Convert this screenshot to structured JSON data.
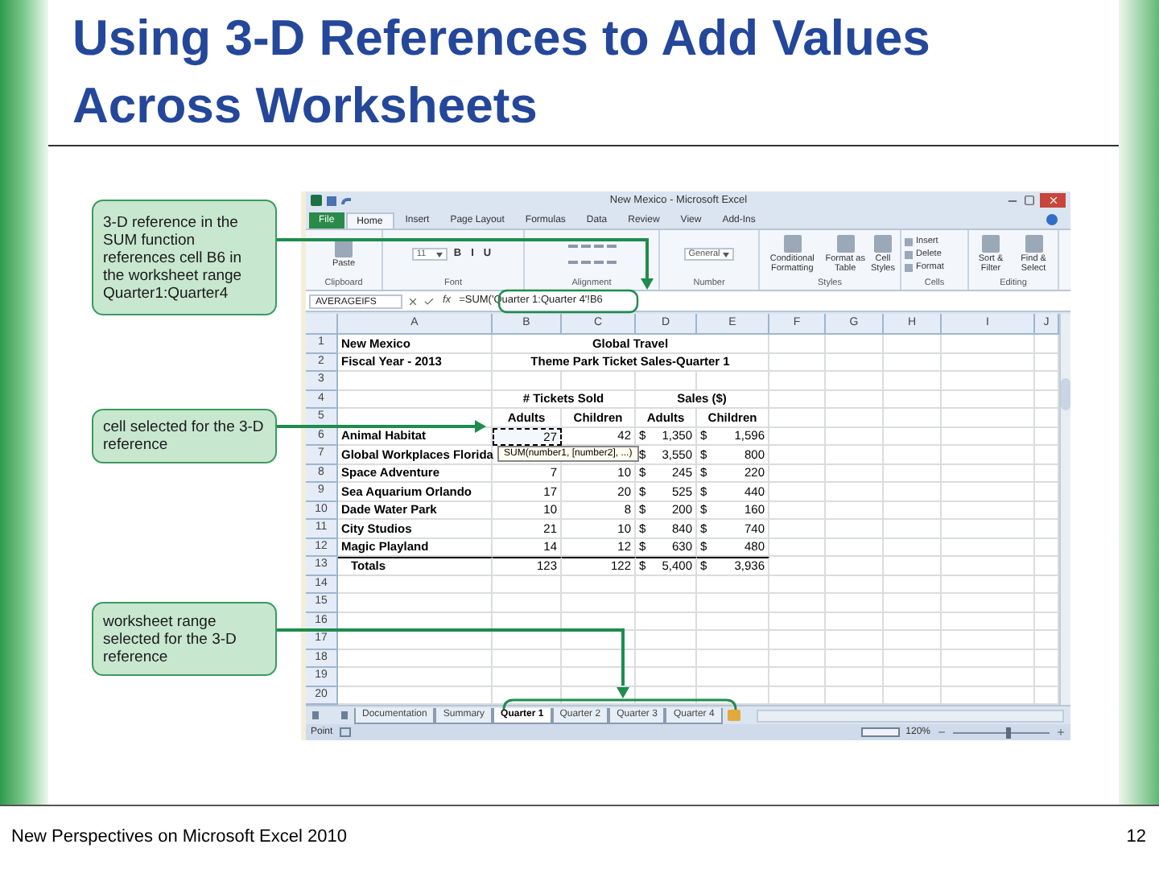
{
  "slide": {
    "title": "Using 3-D References to Add Values Across Worksheets"
  },
  "callouts": [
    {
      "text": "3-D reference in the SUM function references cell B6 in the  worksheet range Quarter1:Quarter4"
    },
    {
      "text": "cell selected for the 3-D reference"
    },
    {
      "text": "worksheet range selected for the 3-D reference"
    }
  ],
  "excel": {
    "window_title": "New Mexico - Microsoft Excel",
    "tabs": [
      {
        "label": "File",
        "kind": "file",
        "selected": false
      },
      {
        "label": "Home",
        "kind": "tab",
        "selected": true
      },
      {
        "label": "Insert",
        "kind": "tab",
        "selected": false
      },
      {
        "label": "Page Layout",
        "kind": "tab",
        "selected": false
      },
      {
        "label": "Formulas",
        "kind": "tab",
        "selected": false
      },
      {
        "label": "Data",
        "kind": "tab",
        "selected": false
      },
      {
        "label": "Review",
        "kind": "tab",
        "selected": false
      },
      {
        "label": "View",
        "kind": "tab",
        "selected": false
      },
      {
        "label": "Add-Ins",
        "kind": "tab",
        "selected": false
      }
    ],
    "ribbon_groups": [
      {
        "label": "Clipboard",
        "buttons": [
          {
            "label": "Paste",
            "kind": "big"
          }
        ]
      },
      {
        "label": "Font",
        "buttons": [
          {
            "label": "11",
            "kind": "dropdown"
          },
          {
            "label": "B",
            "kind": "letter"
          },
          {
            "label": "I",
            "kind": "letter"
          },
          {
            "label": "U",
            "kind": "letter"
          }
        ]
      },
      {
        "label": "Alignment"
      },
      {
        "label": "Number",
        "buttons": [
          {
            "label": "General",
            "kind": "dropdown"
          }
        ]
      },
      {
        "label": "Styles",
        "buttons": [
          {
            "label": "Conditional Formatting",
            "kind": "big"
          },
          {
            "label": "Format as Table",
            "kind": "big"
          },
          {
            "label": "Cell Styles",
            "kind": "big"
          }
        ]
      },
      {
        "label": "Cells",
        "buttons": [
          {
            "label": "Insert",
            "kind": "row"
          },
          {
            "label": "Delete",
            "kind": "row"
          },
          {
            "label": "Format",
            "kind": "row"
          }
        ]
      },
      {
        "label": "Editing",
        "buttons": [
          {
            "label": "Sort & Filter",
            "kind": "big"
          },
          {
            "label": "Find & Select",
            "kind": "big"
          }
        ]
      }
    ],
    "name_box": "AVERAGEIFS",
    "function_label": "fx",
    "formula": "=SUM('Quarter 1:Quarter 4'!B6",
    "columns": [
      "A",
      "B",
      "C",
      "D",
      "E",
      "F",
      "G",
      "H",
      "I",
      "J"
    ],
    "rows": [
      {
        "number": "1",
        "kind": "title",
        "b_selected": false,
        "a": "New Mexico",
        "b_e": "Global Travel"
      },
      {
        "number": "2",
        "kind": "title",
        "b_selected": false,
        "a": "Fiscal Year - 2013",
        "b_e": "Theme Park Ticket Sales-Quarter 1"
      },
      {
        "number": "3",
        "kind": "empty",
        "b_selected": false
      },
      {
        "number": "4",
        "kind": "title",
        "b_selected": false,
        "b_c": "# Tickets Sold",
        "d_e": "Sales ($)"
      },
      {
        "number": "5",
        "kind": "header",
        "b_selected": false,
        "b": "Adults",
        "c": "Children",
        "d": "Adults",
        "e": "Children"
      },
      {
        "number": "6",
        "kind": "data",
        "b_selected": true,
        "a": "Animal Habitat",
        "b": "27",
        "c": "42",
        "d": {
          "symbol": "$",
          "amount": "1,350"
        },
        "e": {
          "symbol": "$",
          "amount": "1,596"
        }
      },
      {
        "number": "7",
        "kind": "data",
        "b_selected": false,
        "a": "Global Workplaces Florida",
        "d": {
          "symbol": "$",
          "amount": "3,550"
        },
        "e": {
          "symbol": "$",
          "amount": "800"
        }
      },
      {
        "number": "8",
        "kind": "data",
        "b_selected": false,
        "a": "Space Adventure",
        "b": "7",
        "c": "10",
        "d": {
          "symbol": "$",
          "amount": "245"
        },
        "e": {
          "symbol": "$",
          "amount": "220"
        }
      },
      {
        "number": "9",
        "kind": "data",
        "b_selected": false,
        "a": "Sea Aquarium Orlando",
        "b": "17",
        "c": "20",
        "d": {
          "symbol": "$",
          "amount": "525"
        },
        "e": {
          "symbol": "$",
          "amount": "440"
        }
      },
      {
        "number": "10",
        "kind": "data",
        "b_selected": false,
        "a": "Dade Water Park",
        "b": "10",
        "c": "8",
        "d": {
          "symbol": "$",
          "amount": "200"
        },
        "e": {
          "symbol": "$",
          "amount": "160"
        }
      },
      {
        "number": "11",
        "kind": "data",
        "b_selected": false,
        "a": "City Studios",
        "b": "21",
        "c": "10",
        "d": {
          "symbol": "$",
          "amount": "840"
        },
        "e": {
          "symbol": "$",
          "amount": "740"
        }
      },
      {
        "number": "12",
        "kind": "data",
        "b_selected": false,
        "a": "Magic Playland",
        "b": "14",
        "c": "12",
        "d": {
          "symbol": "$",
          "amount": "630"
        },
        "e": {
          "symbol": "$",
          "amount": "480"
        }
      },
      {
        "number": "13",
        "kind": "total",
        "b_selected": false,
        "a": "Totals",
        "b": "123",
        "c": "122",
        "d": {
          "symbol": "$",
          "amount": "5,400"
        },
        "e": {
          "symbol": "$",
          "amount": "3,936"
        }
      },
      {
        "number": "14",
        "kind": "empty",
        "b_selected": false
      },
      {
        "number": "15",
        "kind": "empty",
        "b_selected": false
      },
      {
        "number": "16",
        "kind": "empty",
        "b_selected": false
      },
      {
        "number": "17",
        "kind": "empty",
        "b_selected": false
      },
      {
        "number": "18",
        "kind": "empty",
        "b_selected": false
      },
      {
        "number": "19",
        "kind": "empty",
        "b_selected": false
      },
      {
        "number": "20",
        "kind": "empty",
        "b_selected": false
      }
    ],
    "tooltip": "SUM(number1, [number2], ...)",
    "sheet_tabs": [
      {
        "label": "Documentation",
        "selected": false
      },
      {
        "label": "Summary",
        "selected": false
      },
      {
        "label": "Quarter 1",
        "selected": true
      },
      {
        "label": "Quarter 2",
        "selected": false
      },
      {
        "label": "Quarter 3",
        "selected": false
      },
      {
        "label": "Quarter 4",
        "selected": false
      }
    ],
    "status": "Point",
    "zoom": {
      "reading": "120%",
      "level": 0.55
    }
  },
  "footer": {
    "text": "New Perspectives on Microsoft Excel 2010",
    "page": "12"
  }
}
